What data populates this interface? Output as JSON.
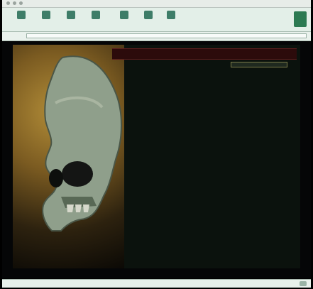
{
  "window": {
    "title": ""
  },
  "toolbar": [],
  "address": {
    "label": "",
    "value": ""
  },
  "page": {
    "banner_title": "",
    "select_value": "",
    "links": [
      "",
      "",
      "",
      "",
      "",
      "",
      "",
      "",
      "",
      "",
      "",
      "",
      "",
      "",
      "",
      "",
      "",
      "",
      "",
      "",
      "",
      "",
      ""
    ],
    "contact": "",
    "footer_cells": [
      "",
      "",
      "",
      ""
    ],
    "footer_bar_items": [
      "",
      "",
      "",
      "",
      ""
    ],
    "footer_bar2_text": ""
  },
  "status": {
    "text": ""
  },
  "colors": {
    "banner_text": "#d7b34a",
    "link_text": "#f0e26a",
    "dark_bg": "#0b120d"
  }
}
